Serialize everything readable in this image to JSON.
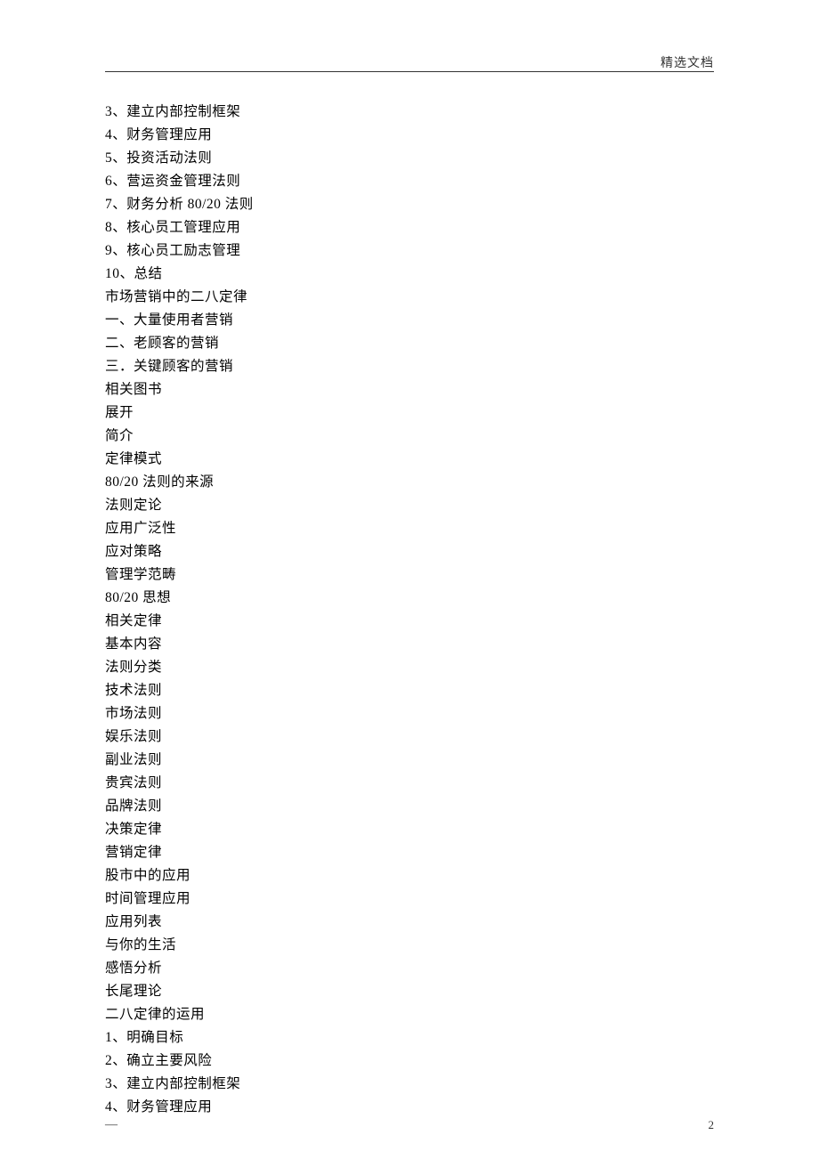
{
  "header": {
    "text": "精选文档"
  },
  "content": {
    "lines": [
      "3、建立内部控制框架",
      "4、财务管理应用",
      "5、投资活动法则",
      "6、营运资金管理法则",
      "7、财务分析 80/20 法则",
      "8、核心员工管理应用",
      "9、核心员工励志管理",
      "10、总结",
      "市场营销中的二八定律",
      "一、大量使用者营销",
      "二、老顾客的营销",
      "三．关键顾客的营销",
      "相关图书",
      "展开",
      "简介",
      "定律模式",
      "80/20 法则的来源",
      "法则定论",
      "应用广泛性",
      "应对策略",
      "管理学范畴",
      "80/20 思想",
      "相关定律",
      "基本内容",
      "法则分类",
      "技术法则",
      "市场法则",
      "娱乐法则",
      "副业法则",
      "贵宾法则",
      "品牌法则",
      "决策定律",
      "营销定律",
      "股市中的应用",
      "时间管理应用",
      "应用列表",
      "与你的生活",
      "感悟分析",
      "长尾理论",
      "二八定律的运用",
      "1、明确目标",
      "2、确立主要风险",
      "3、建立内部控制框架",
      "4、财务管理应用"
    ]
  },
  "footer": {
    "dash": "—",
    "page_number": "2"
  }
}
